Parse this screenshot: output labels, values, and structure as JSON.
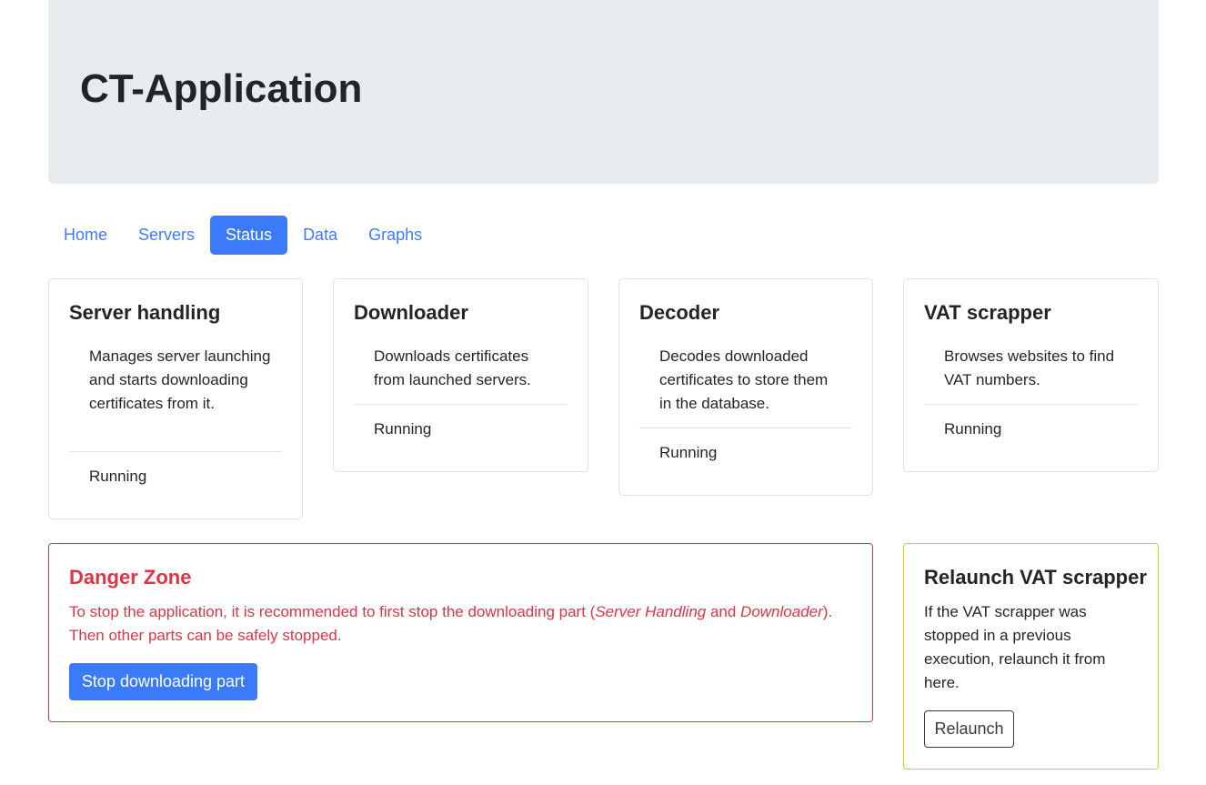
{
  "header": {
    "title": "CT-Application"
  },
  "nav": {
    "items": [
      {
        "label": "Home"
      },
      {
        "label": "Servers"
      },
      {
        "label": "Status",
        "active": true
      },
      {
        "label": "Data"
      },
      {
        "label": "Graphs"
      }
    ]
  },
  "cards": [
    {
      "title": "Server handling",
      "description": "Manages server launching and starts downloading certificates from it.",
      "status": "Running"
    },
    {
      "title": "Downloader",
      "description": "Downloads certificates from launched servers.",
      "status": "Running"
    },
    {
      "title": "Decoder",
      "description": "Decodes downloaded certificates to store them in the database.",
      "status": "Running"
    },
    {
      "title": "VAT scrapper",
      "description": "Browses websites to find VAT numbers.",
      "status": "Running"
    }
  ],
  "danger_zone": {
    "title": "Danger Zone",
    "text_before": "To stop the application, it is recommended to first stop the downloading part (",
    "em_1": "Server Handling",
    "text_and": " and ",
    "em_2": "Downloader",
    "text_after": "). Then other parts can be safely stopped.",
    "button_label": "Stop downloading part"
  },
  "relaunch": {
    "title": "Relaunch VAT scrapper",
    "text": "If the VAT scrapper was stopped in a previous execution, relaunch it from here.",
    "button_label": "Relaunch"
  },
  "colors": {
    "primary": "#3b7bfa",
    "danger": "#dc3545",
    "warning": "#ffc107",
    "jumbotron_bg": "#e9ecef"
  }
}
